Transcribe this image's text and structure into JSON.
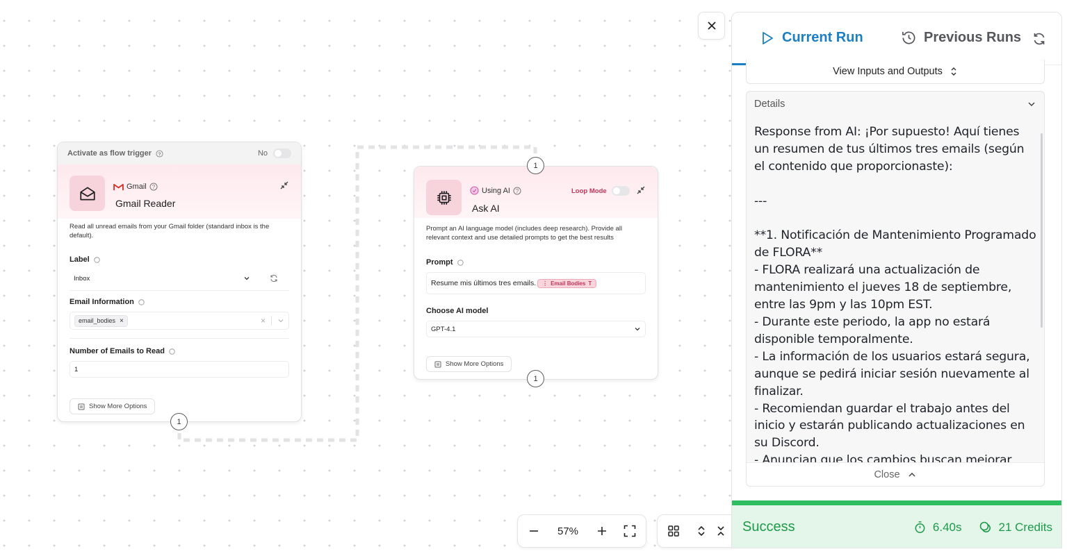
{
  "canvas": {
    "gmail_node": {
      "trigger_label": "Activate as flow trigger",
      "trigger_value": "No",
      "service": "Gmail",
      "title": "Gmail Reader",
      "description": "Read all unread emails from your Gmail folder (standard inbox is the default).",
      "label_field": {
        "label": "Label",
        "value": "Inbox"
      },
      "email_info_field": {
        "label": "Email Information",
        "chip": "email_bodies"
      },
      "count_field": {
        "label": "Number of Emails to Read",
        "value": "1"
      },
      "more_options": "Show More Options",
      "port": "1"
    },
    "ai_node": {
      "service": "Using AI",
      "loop_mode": "Loop Mode",
      "title": "Ask AI",
      "description": "Prompt an AI language model (includes deep research). Provide all relevant context and use detailed prompts to get the best results",
      "prompt_field": {
        "label": "Prompt",
        "value": "Resume mis últimos tres emails.",
        "token": "Email Bodies"
      },
      "model_field": {
        "label": "Choose AI model",
        "value": "GPT-4.1"
      },
      "more_options": "Show More Options",
      "port_top": "1",
      "port_bottom": "1"
    }
  },
  "toolbar": {
    "zoom": "57%"
  },
  "panel": {
    "tabs": [
      {
        "label": "Current Run"
      },
      {
        "label": "Previous Runs"
      }
    ],
    "io_button": "View Inputs and Outputs",
    "details": {
      "title": "Details",
      "body": "Response from AI: ¡Por supuesto! Aquí tienes un resumen de tus últimos tres emails (según el contenido que proporcionaste):\n\n---\n\n**1. Notificación de Mantenimiento Programado de FLORA**\n- FLORA realizará una actualización de mantenimiento el jueves 18 de septiembre, entre las 9pm y las 10pm EST.\n- Durante este periodo, la app no estará disponible temporalmente.\n- La información de los usuarios estará segura, aunque se pedirá iniciar sesión nuevamente al finalizar.\n- Recomiendan guardar el trabajo antes del inicio y estarán publicando actualizaciones en su Discord.\n- Anuncian que los cambios buscan mejorar",
      "close": "Close"
    },
    "status": {
      "label": "Success",
      "duration": "6.40s",
      "credits": "21 Credits"
    }
  },
  "colors": {
    "accent": "#1b7fc4",
    "success": "#1c9a48",
    "success_bar": "#2fbd62",
    "node_tint": "#fde9ee"
  }
}
